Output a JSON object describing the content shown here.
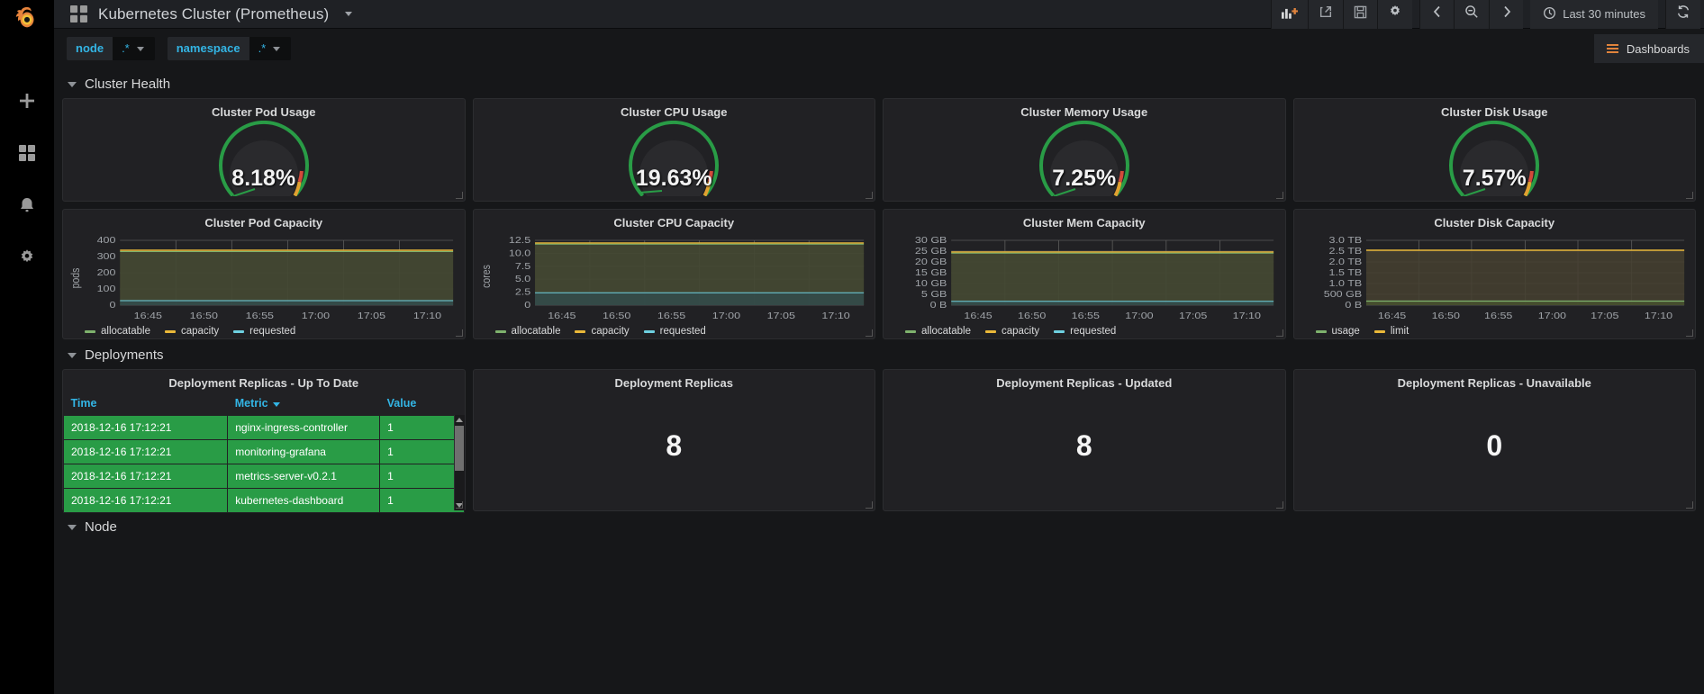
{
  "sidebar": {
    "brand_icon": "grafana-logo",
    "items": [
      {
        "icon": "plus-icon",
        "name": "create"
      },
      {
        "icon": "dashboards-icon",
        "name": "dashboards"
      },
      {
        "icon": "bell-icon",
        "name": "alerting"
      },
      {
        "icon": "gear-icon",
        "name": "configuration"
      }
    ]
  },
  "topnav": {
    "dashboard_icon": "dashboard-grid-icon",
    "title": "Kubernetes Cluster (Prometheus)",
    "buttons": [
      {
        "name": "add-panel",
        "icon": "add-panel-icon"
      },
      {
        "name": "share-dashboard",
        "icon": "share-icon"
      },
      {
        "name": "save-dashboard",
        "icon": "save-icon"
      },
      {
        "name": "dashboard-settings",
        "icon": "gear-icon"
      }
    ],
    "time_nav": [
      {
        "name": "time-shift-back",
        "icon": "chevron-left-icon"
      },
      {
        "name": "zoom-out",
        "icon": "search-minus-icon"
      },
      {
        "name": "time-shift-forward",
        "icon": "chevron-right-icon"
      }
    ],
    "time_range": "Last 30 minutes",
    "time_icon": "clock-icon",
    "refresh_icon": "refresh-icon"
  },
  "submenu": {
    "variables": [
      {
        "label": "node",
        "value": ".*"
      },
      {
        "label": "namespace",
        "value": ".*"
      }
    ],
    "dashboards_button": "Dashboards"
  },
  "rows": [
    {
      "title": "Cluster Health"
    },
    {
      "title": "Deployments"
    },
    {
      "title": "Node"
    }
  ],
  "colors": {
    "green": "#299c46",
    "orange": "#e0a030",
    "red": "#d44a3a",
    "blue": "#33b5e5",
    "allocatable": "#7eb26d",
    "capacity": "#eab839",
    "requested": "#6ed0e0",
    "usage": "#7eb26d",
    "limit": "#eab839"
  },
  "gauges": [
    {
      "title": "Cluster Pod Usage",
      "value": "8.18%",
      "percent": 8.18
    },
    {
      "title": "Cluster CPU Usage",
      "value": "19.63%",
      "percent": 19.63
    },
    {
      "title": "Cluster Memory Usage",
      "value": "7.25%",
      "percent": 7.25
    },
    {
      "title": "Cluster Disk Usage",
      "value": "7.57%",
      "percent": 7.57
    }
  ],
  "chart_data": [
    {
      "type": "area",
      "title": "Cluster Pod Capacity",
      "ylabel": "pods",
      "xlabel": "",
      "ylim": [
        0,
        400
      ],
      "yticks": [
        "0",
        "100",
        "200",
        "300",
        "400"
      ],
      "xticks": [
        "16:45",
        "16:50",
        "16:55",
        "17:00",
        "17:05",
        "17:10"
      ],
      "grid": true,
      "legend": [
        "allocatable",
        "capacity",
        "requested"
      ],
      "legend_position": "bottom-left",
      "series": [
        {
          "name": "allocatable",
          "value": 330,
          "color": "#7eb26d"
        },
        {
          "name": "capacity",
          "value": 335,
          "color": "#eab839"
        },
        {
          "name": "requested",
          "value": 27,
          "color": "#6ed0e0"
        }
      ]
    },
    {
      "type": "area",
      "title": "Cluster CPU Capacity",
      "ylabel": "cores",
      "xlabel": "",
      "ylim": [
        0,
        12.5
      ],
      "yticks": [
        "0",
        "2.5",
        "5.0",
        "7.5",
        "10.0",
        "12.5"
      ],
      "xticks": [
        "16:45",
        "16:50",
        "16:55",
        "17:00",
        "17:05",
        "17:10"
      ],
      "grid": true,
      "legend": [
        "allocatable",
        "capacity",
        "requested"
      ],
      "legend_position": "bottom-left",
      "series": [
        {
          "name": "allocatable",
          "value": 11.8,
          "color": "#7eb26d"
        },
        {
          "name": "capacity",
          "value": 12.0,
          "color": "#eab839"
        },
        {
          "name": "requested",
          "value": 2.4,
          "color": "#6ed0e0"
        }
      ]
    },
    {
      "type": "area",
      "title": "Cluster Mem Capacity",
      "ylabel": "",
      "xlabel": "",
      "ylim": [
        0,
        30
      ],
      "yticks": [
        "0 B",
        "5 GB",
        "10 GB",
        "15 GB",
        "20 GB",
        "25 GB",
        "30 GB"
      ],
      "xticks": [
        "16:45",
        "16:50",
        "16:55",
        "17:00",
        "17:05",
        "17:10"
      ],
      "grid": true,
      "legend": [
        "allocatable",
        "capacity",
        "requested"
      ],
      "legend_position": "bottom-left",
      "series": [
        {
          "name": "allocatable",
          "value": 24.2,
          "color": "#7eb26d"
        },
        {
          "name": "capacity",
          "value": 24.6,
          "color": "#eab839"
        },
        {
          "name": "requested",
          "value": 1.8,
          "color": "#6ed0e0"
        }
      ]
    },
    {
      "type": "area",
      "title": "Cluster Disk Capacity",
      "ylabel": "",
      "xlabel": "",
      "ylim": [
        0,
        3.0
      ],
      "yticks": [
        "0 B",
        "500 GB",
        "1.0 TB",
        "1.5 TB",
        "2.0 TB",
        "2.5 TB",
        "3.0 TB"
      ],
      "xticks": [
        "16:45",
        "16:50",
        "16:55",
        "17:00",
        "17:05",
        "17:10"
      ],
      "grid": true,
      "legend": [
        "usage",
        "limit"
      ],
      "legend_position": "bottom-left",
      "series": [
        {
          "name": "usage",
          "value": 0.19,
          "color": "#7eb26d"
        },
        {
          "name": "limit",
          "value": 2.55,
          "color": "#eab839"
        }
      ]
    }
  ],
  "table_panel": {
    "title": "Deployment Replicas - Up To Date",
    "columns": [
      "Time",
      "Metric",
      "Value"
    ],
    "sorted_column": "Metric",
    "rows": [
      {
        "time": "2018-12-16 17:12:21",
        "metric": "nginx-ingress-controller",
        "value": "1"
      },
      {
        "time": "2018-12-16 17:12:21",
        "metric": "monitoring-grafana",
        "value": "1"
      },
      {
        "time": "2018-12-16 17:12:21",
        "metric": "metrics-server-v0.2.1",
        "value": "1"
      },
      {
        "time": "2018-12-16 17:12:21",
        "metric": "kubernetes-dashboard",
        "value": "1"
      }
    ]
  },
  "stat_panels": [
    {
      "title": "Deployment Replicas",
      "value": "8"
    },
    {
      "title": "Deployment Replicas - Updated",
      "value": "8"
    },
    {
      "title": "Deployment Replicas - Unavailable",
      "value": "0"
    }
  ]
}
